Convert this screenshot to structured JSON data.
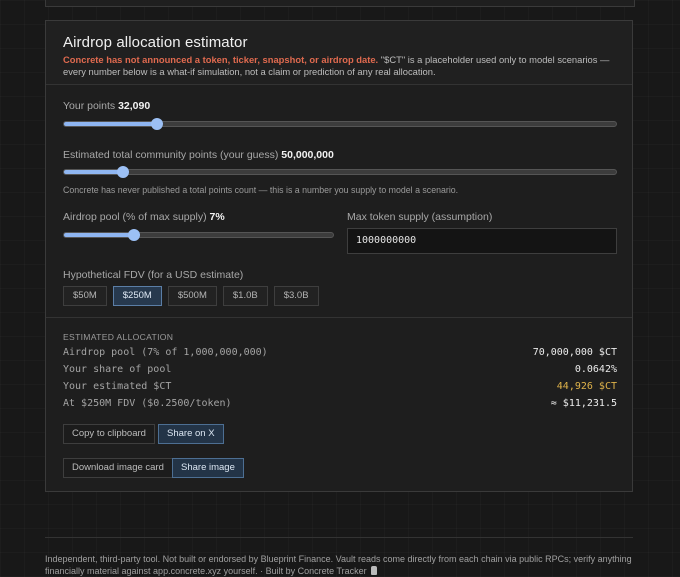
{
  "card": {
    "title": "Airdrop allocation estimator",
    "disclaimer_warning": "Concrete has not announced a token, ticker, snapshot, or airdrop date.",
    "disclaimer_rest": "\"$CT\" is a placeholder used only to model scenarios — every number below is a what-if simulation, not a claim or prediction of any real allocation."
  },
  "points": {
    "label": "Your points",
    "value": "32,090",
    "slider_fraction": 0.168
  },
  "community": {
    "label": "Estimated total community points (your guess)",
    "value": "50,000,000",
    "slider_fraction": 0.107,
    "note": "Concrete has never published a total points count — this is a number you supply to model a scenario."
  },
  "pool": {
    "label": "Airdrop pool (% of max supply)",
    "value": "7%",
    "slider_fraction": 0.26
  },
  "supply": {
    "label": "Max token supply (assumption)",
    "value": "1000000000"
  },
  "fdv": {
    "label": "Hypothetical FDV (for a USD estimate)",
    "options": [
      "$50M",
      "$250M",
      "$500M",
      "$1.0B",
      "$3.0B"
    ],
    "selected": "$250M"
  },
  "allocation": {
    "section_title": "ESTIMATED ALLOCATION",
    "rows": [
      {
        "key": "Airdrop pool (7% of 1,000,000,000)",
        "value": "70,000,000 $CT"
      },
      {
        "key": "Your share of pool",
        "value": "0.0642%"
      },
      {
        "key": "Your estimated $CT",
        "value": "44,926 $CT"
      },
      {
        "key": "At $250M FDV ($0.2500/token)",
        "value": "≈ $11,231.5"
      }
    ],
    "highlight_color": "#e0b34a"
  },
  "actions": {
    "copy_label": "Copy to clipboard",
    "share_x_label": "Share on X",
    "download_label": "Download image card",
    "share_image_label": "Share image"
  },
  "footer": {
    "text": "Independent, third-party tool. Not built or endorsed by Blueprint Finance. Vault reads come directly from each chain via public RPCs; verify anything financially material against app.concrete.xyz yourself. · Built by Concrete Tracker"
  },
  "colors": {
    "accent": "#8fb6f2",
    "warning": "#e06a4f"
  }
}
